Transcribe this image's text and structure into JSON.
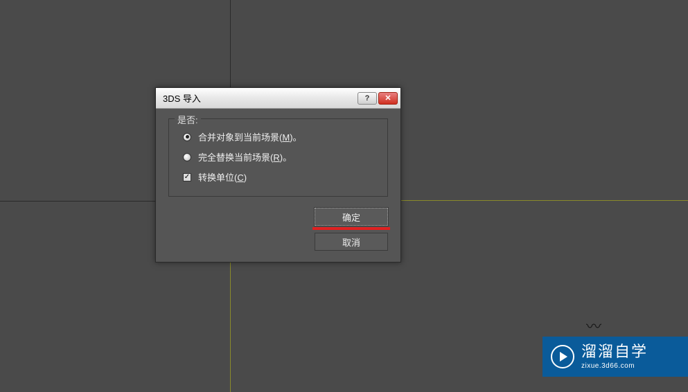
{
  "dialog": {
    "title": "3DS 导入",
    "help_glyph": "?",
    "close_glyph": "✕",
    "fieldset_legend": "是否:",
    "options": {
      "merge": {
        "label_pre": "合并对象到当前场景(",
        "key": "M",
        "label_post": ")。"
      },
      "replace": {
        "label_pre": "完全替换当前场景(",
        "key": "R",
        "label_post": ")。"
      },
      "convert": {
        "label_pre": "转换单位(",
        "key": "C",
        "label_post": ")"
      }
    },
    "check_glyph": "✓",
    "ok_label": "确定",
    "cancel_label": "取消"
  },
  "watermark": {
    "title": "溜溜自学",
    "sub": "zixue.3d66.com"
  }
}
